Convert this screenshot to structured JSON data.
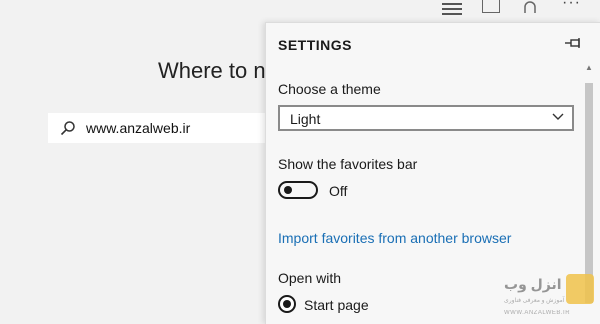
{
  "ntp": {
    "heading": "Where to n",
    "search_value": "www.anzalweb.ir"
  },
  "toolbar": {
    "icons": [
      "hub-icon",
      "web-note-icon",
      "share-icon",
      "more-icon"
    ],
    "more_glyph": "···"
  },
  "settings": {
    "title": "SETTINGS",
    "theme": {
      "label": "Choose a theme",
      "selected": "Light"
    },
    "favorites_bar": {
      "label": "Show the favorites bar",
      "state": "Off"
    },
    "import_link": "Import favorites from another browser",
    "open_with": {
      "label": "Open with",
      "option": "Start page",
      "selected": true
    }
  },
  "watermark": {
    "text": "انزل وب",
    "sub": "آموزش و معرفی فناوری",
    "url": "WWW.ANZALWEB.IR"
  },
  "colors": {
    "link": "#1a6fb5",
    "panel_bg": "#f7f7f7",
    "page_bg": "#f2f2f2"
  }
}
